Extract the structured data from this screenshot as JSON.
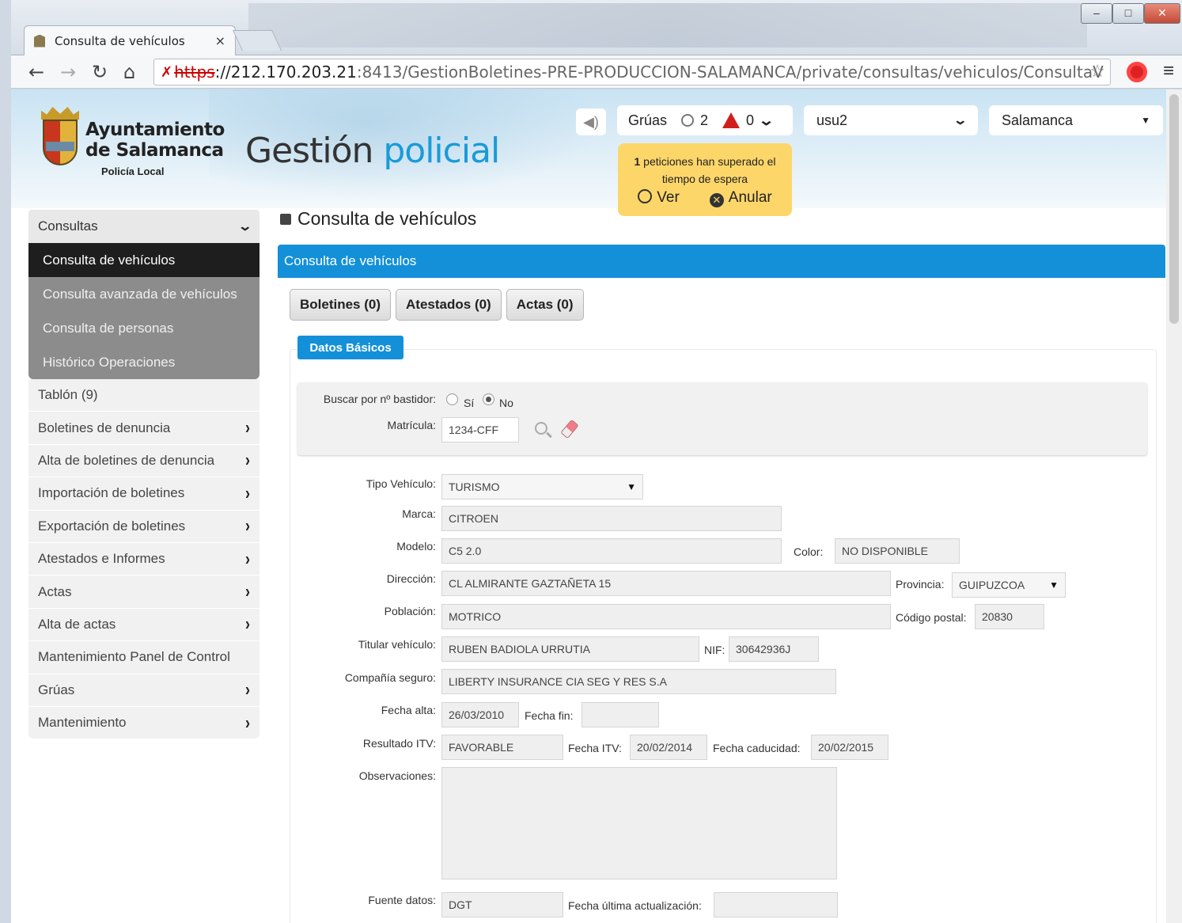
{
  "browser": {
    "tab_title": "Consulta de vehículos",
    "url_protocol": "https",
    "url_host": "://212.170.203.21",
    "url_path": ":8413/GestionBoletines-PRE-PRODUCCION-SALAMANCA/private/consultas/vehiculos/ConsultaV"
  },
  "header": {
    "logo_line1": "Ayuntamiento",
    "logo_line2": "de Salamanca",
    "logo_sub": "Policía Local",
    "app_title_part1": "Gestión ",
    "app_title_part2": "policial",
    "gruas_label": "Grúas",
    "gruas_clock_count": "2",
    "gruas_warn_count": "0",
    "user": "usu2",
    "city": "Salamanca",
    "alert_count": "1",
    "alert_text1": " peticiones han superado el",
    "alert_text2": "tiempo de espera",
    "alert_view": "Ver",
    "alert_cancel": "Anular"
  },
  "sidebar": {
    "section": "Consultas",
    "sub_items": [
      "Consulta de vehículos",
      "Consulta avanzada de vehículos",
      "Consulta de personas",
      "Histórico Operaciones"
    ],
    "items": [
      {
        "label": "Tablón (9)",
        "arrow": false
      },
      {
        "label": "Boletines de denuncia",
        "arrow": true
      },
      {
        "label": "Alta de boletines de denuncia",
        "arrow": true
      },
      {
        "label": "Importación de boletines",
        "arrow": true
      },
      {
        "label": "Exportación de boletines",
        "arrow": true
      },
      {
        "label": "Atestados e Informes",
        "arrow": true
      },
      {
        "label": "Actas",
        "arrow": true
      },
      {
        "label": "Alta de actas",
        "arrow": true
      },
      {
        "label": "Mantenimiento Panel de Control",
        "arrow": false
      },
      {
        "label": "Grúas",
        "arrow": true
      },
      {
        "label": "Mantenimiento",
        "arrow": true
      }
    ]
  },
  "main": {
    "title": "Consulta de vehículos",
    "panel_title": "Consulta de vehículos",
    "tabs": [
      "Boletines (0)",
      "Atestados (0)",
      "Actas (0)"
    ],
    "section": "Datos Básicos"
  },
  "form": {
    "search_bastidor_label": "Buscar por nº bastidor:",
    "opt_si": "Sí",
    "opt_no": "No",
    "matricula_label": "Matrícula:",
    "matricula_value": "1234-CFF",
    "tipo_label": "Tipo Vehículo:",
    "tipo_value": "TURISMO",
    "marca_label": "Marca:",
    "marca_value": "CITROEN",
    "modelo_label": "Modelo:",
    "modelo_value": "C5 2.0",
    "color_label": "Color:",
    "color_value": "NO DISPONIBLE",
    "direccion_label": "Dirección:",
    "direccion_value": "CL ALMIRANTE GAZTAÑETA 15",
    "provincia_label": "Provincia:",
    "provincia_value": "GUIPUZCOA",
    "poblacion_label": "Población:",
    "poblacion_value": "MOTRICO",
    "cp_label": "Código postal:",
    "cp_value": "20830",
    "titular_label": "Titular vehículo:",
    "titular_value": "RUBEN BADIOLA URRUTIA",
    "nif_label": "NIF:",
    "nif_value": "30642936J",
    "seguro_label": "Compañía seguro:",
    "seguro_value": "LIBERTY INSURANCE CIA SEG Y RES S.A",
    "alta_label": "Fecha alta:",
    "alta_value": "26/03/2010",
    "fin_label": "Fecha fin:",
    "fin_value": "",
    "itv_label": "Resultado ITV:",
    "itv_value": "FAVORABLE",
    "fecha_itv_label": "Fecha ITV:",
    "fecha_itv_value": "20/02/2014",
    "caducidad_label": "Fecha caducidad:",
    "caducidad_value": "20/02/2015",
    "obs_label": "Observaciones:",
    "fuente_label": "Fuente datos:",
    "fuente_value": "DGT",
    "ultima_label": "Fecha última actualización:",
    "ultima_value": ""
  },
  "colors": {
    "accent": "#1490d8",
    "alert": "#fdd66a",
    "sidebar_active": "#1e1e1e"
  }
}
